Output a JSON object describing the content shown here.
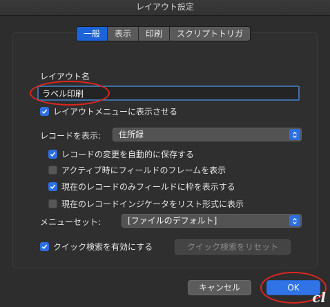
{
  "window": {
    "title": "レイアウト設定"
  },
  "tabs": [
    {
      "label": "一般",
      "active": true
    },
    {
      "label": "表示",
      "active": false
    },
    {
      "label": "印刷",
      "active": false
    },
    {
      "label": "スクリプトトリガ",
      "active": false
    }
  ],
  "layout_name": {
    "label": "レイアウト名",
    "value": "ラベル印刷"
  },
  "options": {
    "show_in_menu": {
      "label": "レイアウトメニューに表示させる",
      "checked": true
    },
    "show_records": {
      "label": "レコードを表示:",
      "selected": "住所録"
    },
    "save_auto": {
      "label": "レコードの変更を自動的に保存する",
      "checked": true
    },
    "frame_active": {
      "label": "アクティブ時にフィールドのフレームを表示",
      "checked": false
    },
    "current_only": {
      "label": "現在のレコードのみフィールドに枠を表示する",
      "checked": true
    },
    "indicator": {
      "label": "現在のレコードインジケータをリスト形式に表示",
      "checked": false
    },
    "menu_set": {
      "label": "メニューセット:",
      "selected": "[ファイルのデフォルト]"
    },
    "quick_find": {
      "label": "クイック検索を有効にする",
      "checked": true
    },
    "reset_quick": {
      "label": "クイック検索をリセット"
    }
  },
  "buttons": {
    "cancel": "キャンセル",
    "ok": "OK"
  },
  "watermark": "cl",
  "colors": {
    "accent": "#2f73e6",
    "highlight_oval": "#e0261f"
  }
}
